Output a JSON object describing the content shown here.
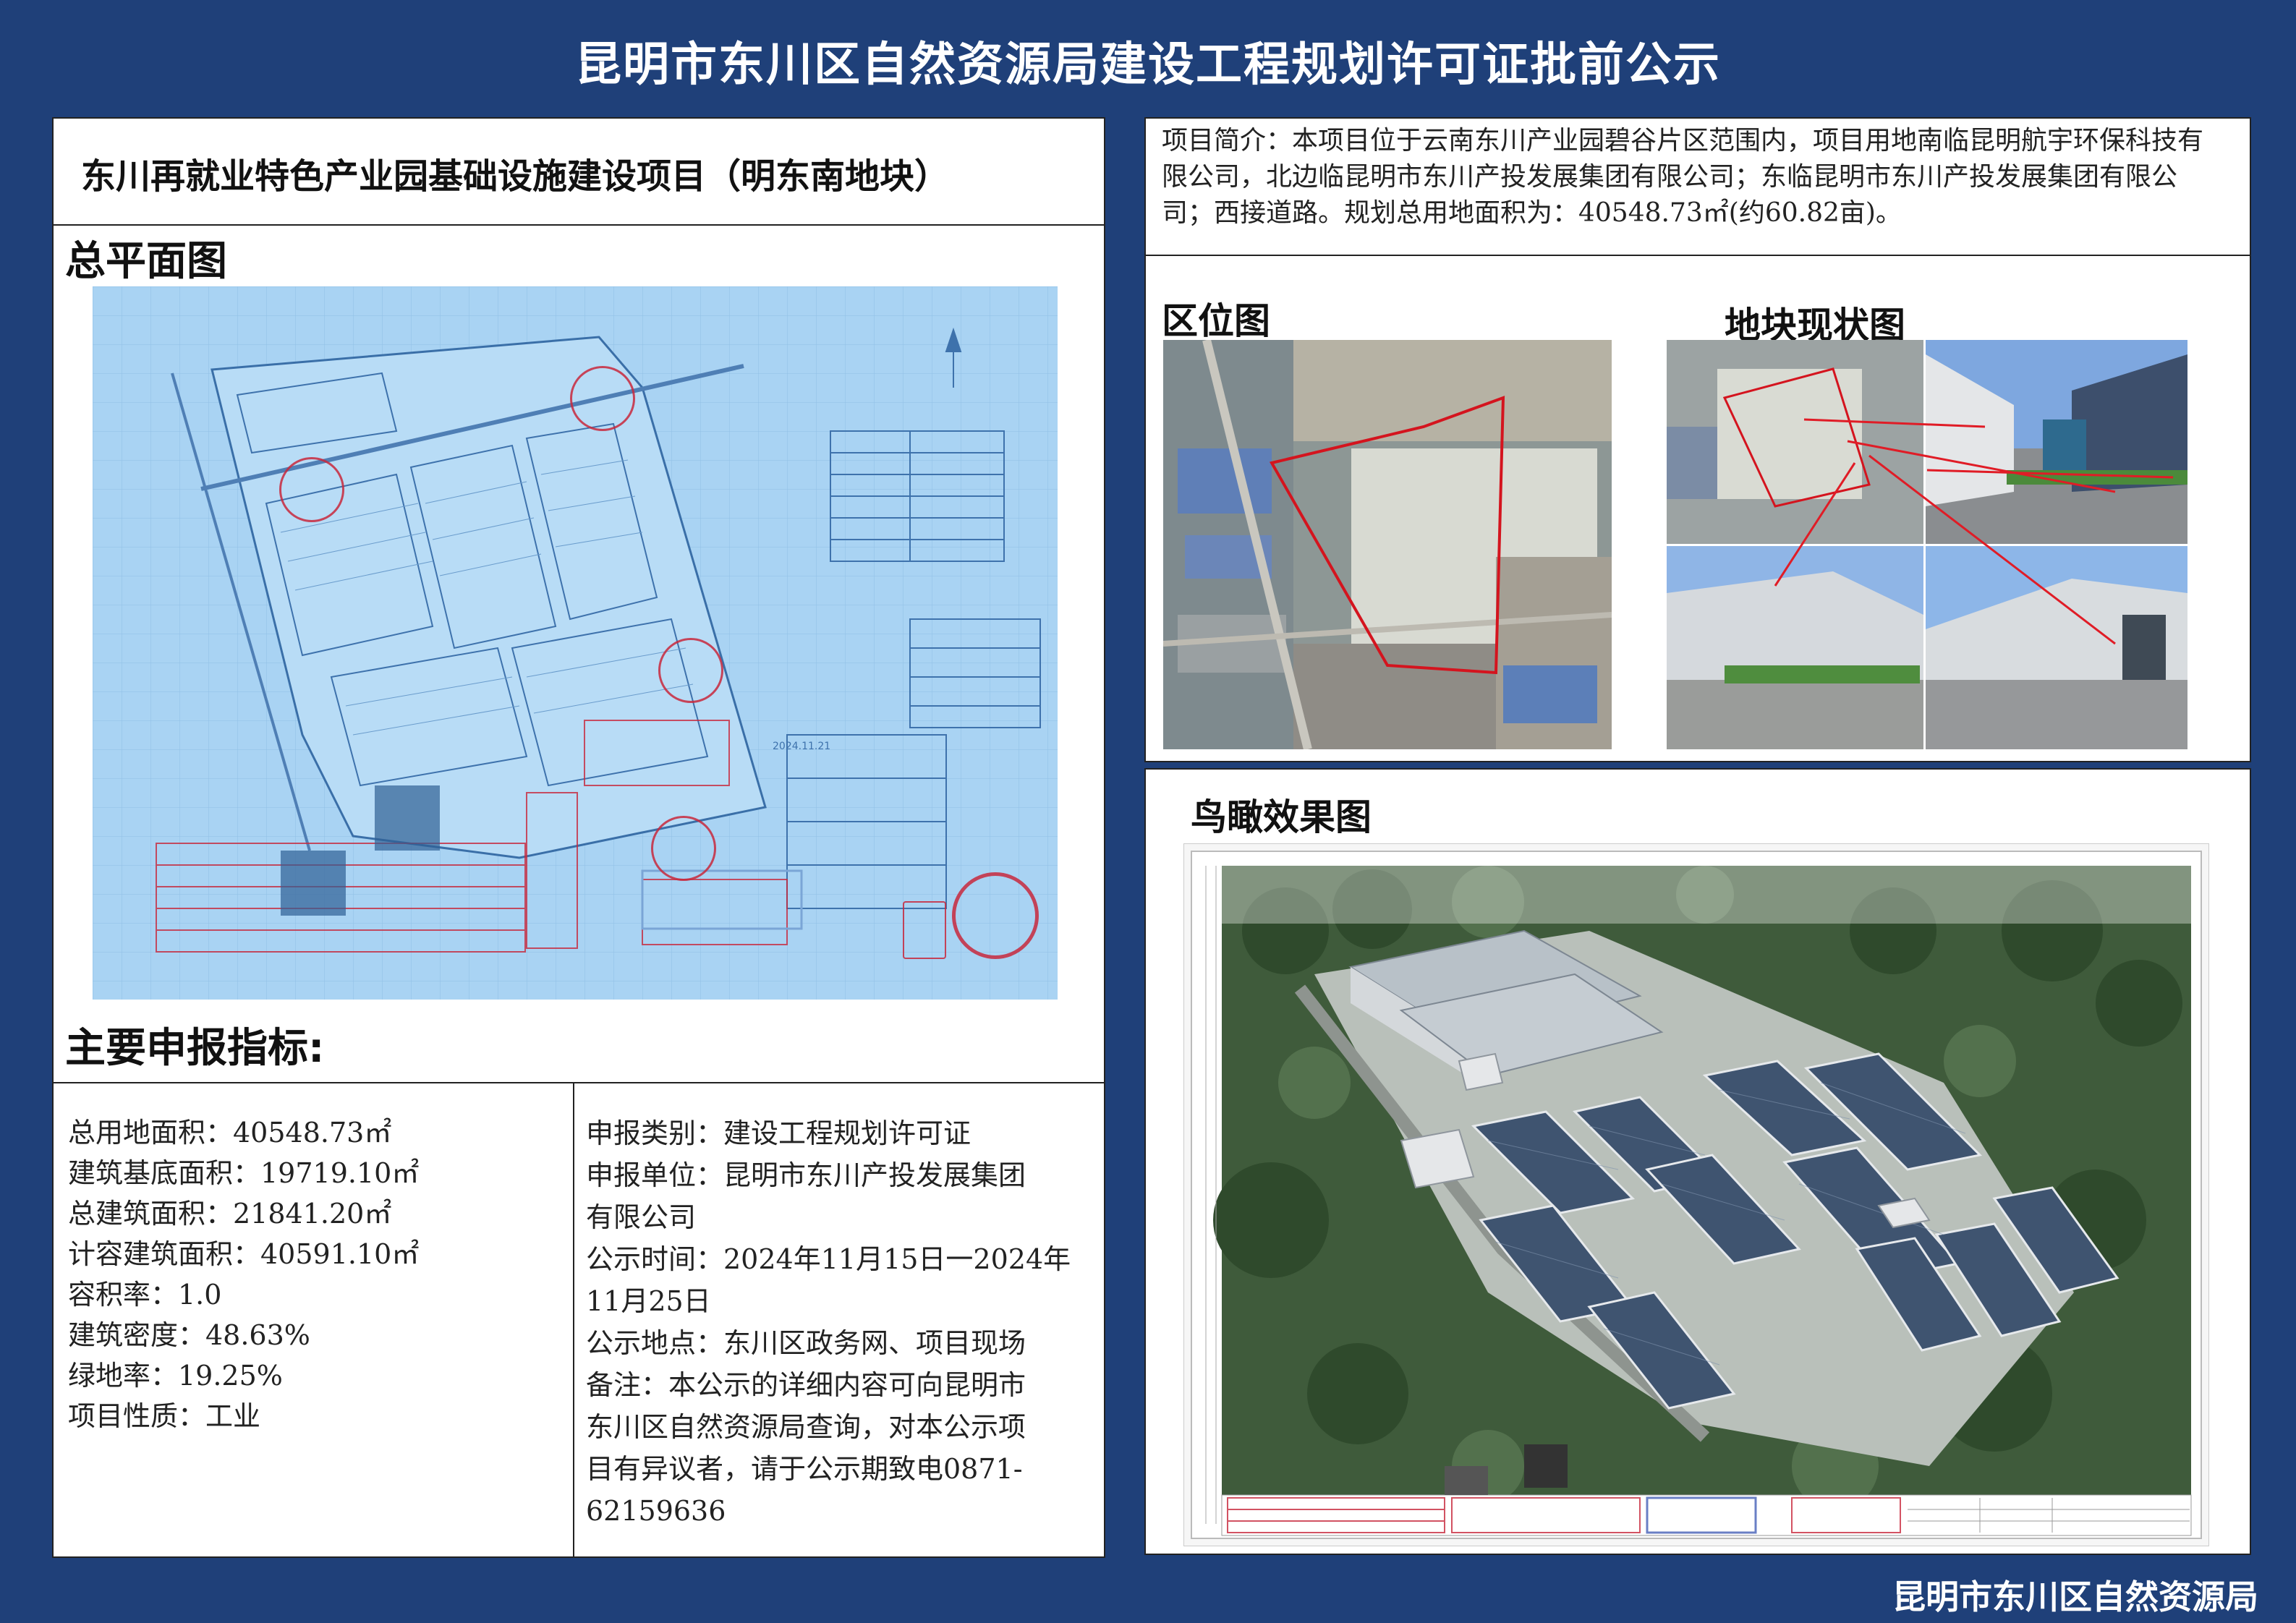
{
  "header": {
    "title": "昆明市东川区自然资源局建设工程规划许可证批前公示"
  },
  "project": {
    "title": "东川再就业特色产业园基础设施建设项目（明东南地块）"
  },
  "sections": {
    "site_plan": "总平面图",
    "indicators": "主要申报指标:",
    "location_map": "区位图",
    "site_status": "地块现状图",
    "aerial": "鸟瞰效果图"
  },
  "site_plan_image": {
    "stamp_date": "2024.11.21"
  },
  "intro": "项目简介：本项目位于云南东川产业园碧谷片区范围内，项目用地南临昆明航宇环保科技有限公司，北边临昆明市东川产投发展集团有限公司；东临昆明市东川产投发展集团有限公司；西接道路。规划总用地面积为：40548.73㎡(约60.82亩)。",
  "indicators": [
    "总用地面积：40548.73㎡",
    "建筑基底面积：19719.10㎡",
    "总建筑面积：21841.20㎡",
    "计容建筑面积：40591.10㎡",
    "容积率：1.0",
    "建筑密度：48.63%",
    "绿地率：19.25%",
    "项目性质：工业"
  ],
  "application": [
    "申报类别：建设工程规划许可证",
    "申报单位：昆明市东川产投发展集团",
    "有限公司",
    "公示时间：2024年11月15日一2024年",
    "11月25日",
    "公示地点：东川区政务网、项目现场",
    "备注：本公示的详细内容可向昆明市",
    "东川区自然资源局查询，对本公示项",
    "目有异议者，请于公示期致电0871-",
    "62159636"
  ],
  "footer": {
    "org": "昆明市东川区自然资源局"
  },
  "colors": {
    "background": "#1f4079",
    "blueprint": "#a9d3f3",
    "stamp_red": "#c8283c"
  }
}
